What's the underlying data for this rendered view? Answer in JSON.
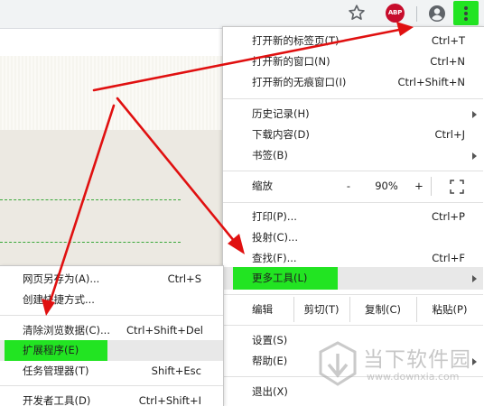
{
  "toolbar": {
    "abp_label": "ABP"
  },
  "main_menu": {
    "items_top": [
      {
        "label": "打开新的标签页(T)",
        "shortcut": "Ctrl+T"
      },
      {
        "label": "打开新的窗口(N)",
        "shortcut": "Ctrl+N"
      },
      {
        "label": "打开新的无痕窗口(I)",
        "shortcut": "Ctrl+Shift+N"
      }
    ],
    "items_history": [
      {
        "label": "历史记录(H)"
      },
      {
        "label": "下载内容(D)",
        "shortcut": "Ctrl+J"
      },
      {
        "label": "书签(B)"
      }
    ],
    "zoom": {
      "label": "缩放",
      "minus": "-",
      "value": "90%",
      "plus": "+"
    },
    "items_tools": [
      {
        "label": "打印(P)...",
        "shortcut": "Ctrl+P"
      },
      {
        "label": "投射(C)..."
      },
      {
        "label": "查找(F)...",
        "shortcut": "Ctrl+F"
      },
      {
        "label": "更多工具(L)"
      }
    ],
    "edit": {
      "label": "编辑",
      "cut": "剪切(T)",
      "copy": "复制(C)",
      "paste": "粘贴(P)"
    },
    "items_settings": [
      {
        "label": "设置(S)"
      },
      {
        "label": "帮助(E)"
      }
    ],
    "exit": {
      "label": "退出(X)"
    }
  },
  "sub_menu": {
    "items": [
      {
        "label": "网页另存为(A)...",
        "shortcut": "Ctrl+S"
      },
      {
        "label": "创建快捷方式..."
      },
      {
        "label": "清除浏览数据(C)...",
        "shortcut": "Ctrl+Shift+Del"
      },
      {
        "label": "扩展程序(E)"
      },
      {
        "label": "任务管理器(T)",
        "shortcut": "Shift+Esc"
      },
      {
        "label": "开发者工具(D)",
        "shortcut": "Ctrl+Shift+I"
      }
    ]
  },
  "watermark": {
    "text": "当下软件园",
    "url": "www.downxia.com"
  },
  "colors": {
    "highlight_green": "#22e422",
    "arrow_red": "#e01010"
  }
}
